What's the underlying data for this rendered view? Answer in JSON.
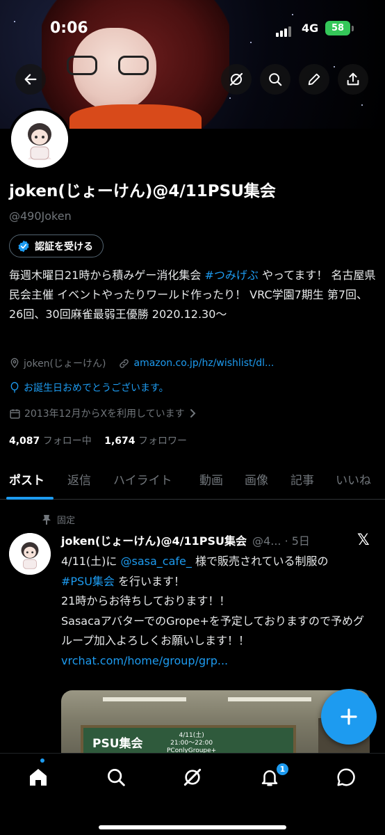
{
  "status_bar": {
    "time": "0:06",
    "network": "4G",
    "battery": "58"
  },
  "profile": {
    "name": "joken(じょーけん)@4/11PSU集会",
    "handle": "@490Joken",
    "verify_button": "認証を受ける",
    "bio_prefix": "毎週木曜日21時から積みゲー消化集会 ",
    "bio_hashtag": "#つみげぶ",
    "bio_rest": " やってます！ 名古屋県民会主催 イベントやったりワールド作ったり！ VRC学園7期生 第7回、26回、30回麻雀最弱王優勝 2020.12.30〜",
    "location": "joken(じょーけん)",
    "website": "amazon.co.jp/hz/wishlist/dl...",
    "birthday": "お誕生日おめでとうございます。",
    "joined": "2013年12月からXを利用しています",
    "following_count": "4,087",
    "following_label": " フォロー中",
    "followers_count": "1,674",
    "followers_label": " フォロワー"
  },
  "tabs": [
    "ポスト",
    "返信",
    "ハイライト",
    "動画",
    "画像",
    "記事",
    "いいね"
  ],
  "pinned_label": "固定",
  "tweet": {
    "name": "joken(じょーけん)@4/11PSU集会",
    "meta": "@4... · 5日",
    "line1_prefix": "4/11(土)に ",
    "line1_mention": "@sasa_cafe_",
    "line1_suffix": " 様で販売されている制服の",
    "line2_hashtag": "#PSU集会",
    "line2_suffix": " を行います！",
    "line3": "21時からお待ちしております！！",
    "line4": "SasacaアバターでのGrope+を予定しておりますので予めグループ加入よろしくお願いします！！",
    "link": "vrchat.com/home/group/grp...",
    "media_title": "PSU集会",
    "media_date1": "4/11(土)",
    "media_date2": "21:00〜22:00",
    "media_date3": "PConlyGroupe+"
  },
  "notifications_badge": "1",
  "icons": [
    "back-arrow-icon",
    "grok-icon",
    "search-icon",
    "edit-icon",
    "share-icon",
    "verified-badge-icon",
    "location-icon",
    "link-icon",
    "balloon-icon",
    "calendar-icon",
    "chevron-right-icon",
    "pin-icon",
    "x-logo-icon",
    "plus-icon",
    "home-icon",
    "notifications-icon",
    "messages-icon"
  ],
  "colors": {
    "accent": "#1d9bf0",
    "background": "#000000",
    "secondary_text": "#71767b",
    "battery": "#34c759"
  }
}
